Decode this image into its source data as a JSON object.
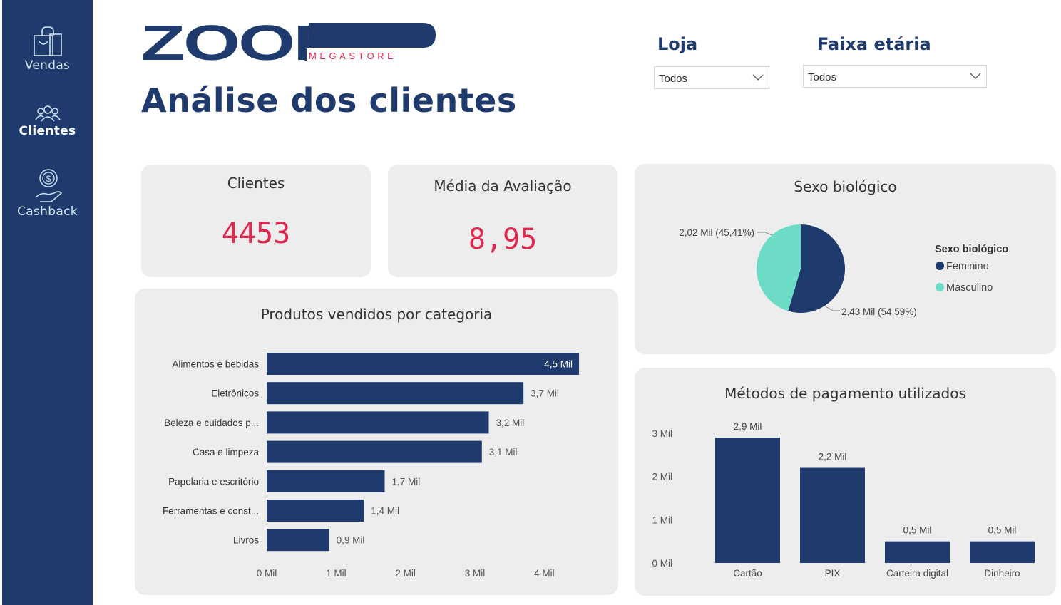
{
  "nav": {
    "items": [
      {
        "label": "Vendas",
        "icon": "shopping-bag-icon"
      },
      {
        "label": "Clientes",
        "icon": "users-icon",
        "active": true
      },
      {
        "label": "Cashback",
        "icon": "cashback-hand-icon"
      }
    ]
  },
  "brand": {
    "name": "ZOOP",
    "sub": "MEGASTORE"
  },
  "page_title": "Análise dos clientes",
  "filters": {
    "loja": {
      "label": "Loja",
      "value": "Todos"
    },
    "faixa": {
      "label": "Faixa etária",
      "value": "Todos"
    }
  },
  "kpis": {
    "clientes": {
      "title": "Clientes",
      "value": "4453"
    },
    "avaliacao": {
      "title": "Média da Avaliação",
      "value": "8,95"
    }
  },
  "colors": {
    "primary": "#1f3b6e",
    "accent": "#e0284f",
    "secondary": "#6cdcc6",
    "card": "#ededed"
  },
  "chart_data": [
    {
      "type": "bar",
      "orientation": "horizontal",
      "title": "Produtos vendidos por categoria",
      "categories": [
        "Alimentos e bebidas",
        "Eletrônicos",
        "Beleza e cuidados p...",
        "Casa e limpeza",
        "Papelaria e escritório",
        "Ferramentas e const...",
        "Livros"
      ],
      "values": [
        4.5,
        3.7,
        3.2,
        3.1,
        1.7,
        1.4,
        0.9
      ],
      "labels": [
        "4,5 Mil",
        "3,7 Mil",
        "3,2 Mil",
        "3,1 Mil",
        "1,7 Mil",
        "1,4 Mil",
        "0,9 Mil"
      ],
      "x_ticks": [
        "0 Mil",
        "1 Mil",
        "2 Mil",
        "3 Mil",
        "4 Mil"
      ],
      "xlim": [
        0,
        4.9
      ]
    },
    {
      "type": "pie",
      "title": "Sexo biológico",
      "legend_title": "Sexo biológico",
      "legend_position": "right",
      "series": [
        {
          "name": "Feminino",
          "value": 2.43,
          "label": "2,43 Mil (54,59%)",
          "color": "#1f3b6e"
        },
        {
          "name": "Masculino",
          "value": 2.02,
          "label": "2,02 Mil (45,41%)",
          "color": "#6cdcc6"
        }
      ]
    },
    {
      "type": "bar",
      "orientation": "vertical",
      "title": "Métodos de pagamento utilizados",
      "categories": [
        "Cartão",
        "PIX",
        "Carteira digital",
        "Dinheiro"
      ],
      "values": [
        2.9,
        2.2,
        0.5,
        0.5
      ],
      "labels": [
        "2,9 Mil",
        "2,2 Mil",
        "0,5 Mil",
        "0,5 Mil"
      ],
      "y_ticks": [
        "0 Mil",
        "1 Mil",
        "2 Mil",
        "3 Mil"
      ],
      "ylim": [
        0,
        3
      ]
    }
  ]
}
